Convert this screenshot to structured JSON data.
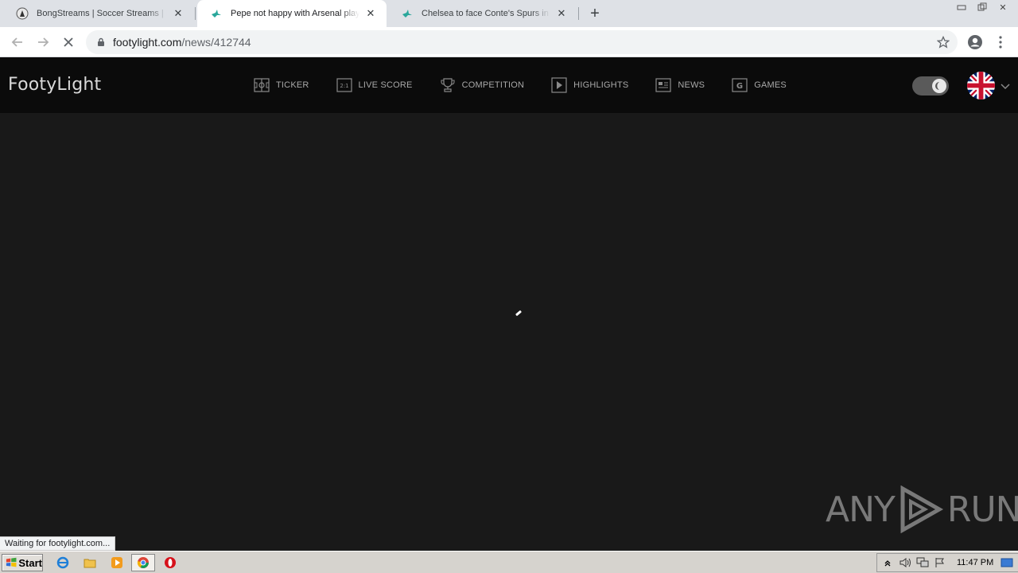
{
  "browser": {
    "tabs": [
      {
        "title": "BongStreams | Soccer Streams | NBA Streams",
        "active": false
      },
      {
        "title": "Pepe not happy with Arsenal playing time",
        "active": true
      },
      {
        "title": "Chelsea to face Conte's Spurs in EFL Cup",
        "active": false
      }
    ],
    "url_domain": "footylight.com",
    "url_path": "/news/412744",
    "status_text": "Waiting for footylight.com..."
  },
  "site": {
    "logo": "FootyLight",
    "nav": [
      {
        "label": "TICKER",
        "icon": "ticker-icon"
      },
      {
        "label": "LIVE SCORE",
        "icon": "live-score-icon"
      },
      {
        "label": "COMPETITION",
        "icon": "trophy-icon"
      },
      {
        "label": "HIGHLIGHTS",
        "icon": "play-icon"
      },
      {
        "label": "NEWS",
        "icon": "news-icon"
      },
      {
        "label": "GAMES",
        "icon": "games-icon"
      }
    ],
    "theme_toggle": "dark",
    "language": "uk-flag-icon"
  },
  "watermark": {
    "left": "ANY",
    "right": "RUN"
  },
  "taskbar": {
    "start_label": "Start",
    "clock": "11:47 PM"
  }
}
